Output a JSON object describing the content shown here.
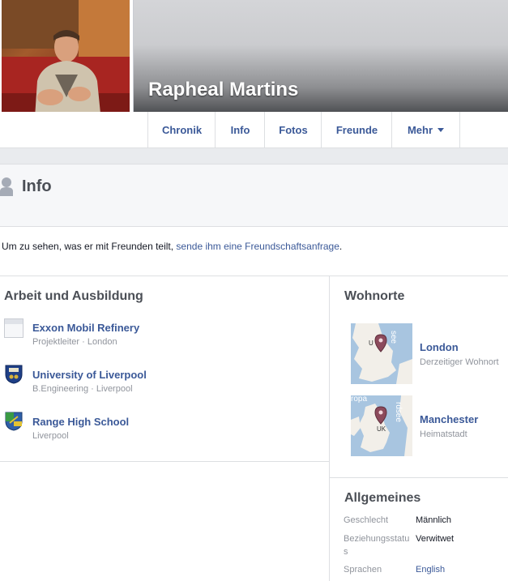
{
  "profile": {
    "name": "Rapheal Martins"
  },
  "tabs": [
    {
      "label": "Chronik"
    },
    {
      "label": "Info"
    },
    {
      "label": "Fotos"
    },
    {
      "label": "Freunde"
    },
    {
      "label": "Mehr"
    }
  ],
  "info": {
    "title": "Info",
    "notice_text": "Um zu sehen, was er mit Freunden teilt, ",
    "notice_link": "sende ihm eine Freundschaftsanfrage",
    "notice_end": "."
  },
  "work": {
    "title": "Arbeit und Ausbildung",
    "items": [
      {
        "name": "Exxon Mobil Refinery",
        "detail": "Projektleiter · London",
        "icon": "workplace-icon"
      },
      {
        "name": "University of Liverpool",
        "detail": "B.Engineering · Liverpool",
        "icon": "university-crest-icon"
      },
      {
        "name": "Range High School",
        "detail": "Liverpool",
        "icon": "school-crest-icon"
      }
    ]
  },
  "places": {
    "title": "Wohnorte",
    "items": [
      {
        "name": "London",
        "detail": "Derzeitiger Wohnort",
        "map_labels": [
          "see",
          "U"
        ]
      },
      {
        "name": "Manchester",
        "detail": "Heimatstadt",
        "map_labels": [
          "ropa",
          "rdsee",
          "UK"
        ]
      }
    ]
  },
  "general": {
    "title": "Allgemeines",
    "rows": [
      {
        "label": "Geschlecht",
        "value": "Männlich"
      },
      {
        "label_line1": "Beziehungsstatu",
        "label_line2": "s",
        "value": "Verwitwet"
      },
      {
        "label": "Sprachen",
        "value": "English"
      }
    ]
  },
  "colors": {
    "link": "#3b5998",
    "muted": "#90949c",
    "divider": "#dddfe2"
  }
}
